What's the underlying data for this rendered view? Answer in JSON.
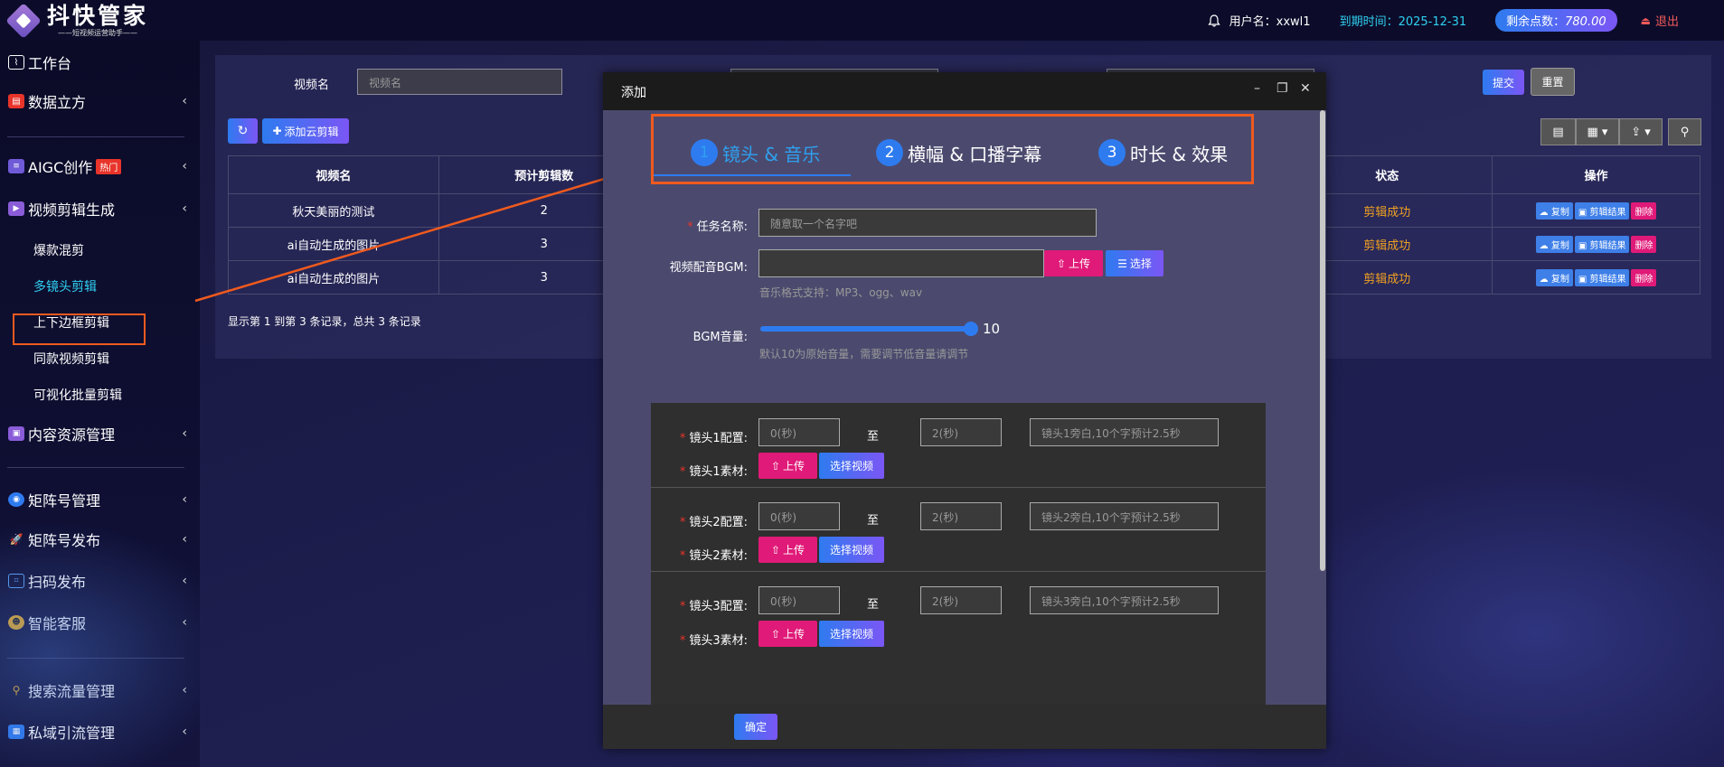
{
  "header": {
    "logo_title": "抖快管家",
    "logo_sub": "——短视频运营助手——",
    "username": "用户名：xxwl1",
    "expire": "到期时间：2025-12-31",
    "points_label": "剩余点数：",
    "points_value": "780.00",
    "logout": "退出"
  },
  "sidebar": {
    "items": [
      {
        "label": "工作台"
      },
      {
        "label": "数据立方"
      },
      {
        "label": "AIGC创作",
        "badge": "热门"
      },
      {
        "label": "视频剪辑生成"
      },
      {
        "label": "内容资源管理"
      },
      {
        "label": "矩阵号管理"
      },
      {
        "label": "矩阵号发布"
      },
      {
        "label": "扫码发布"
      },
      {
        "label": "智能客服"
      },
      {
        "label": "搜索流量管理"
      },
      {
        "label": "私域引流管理"
      }
    ],
    "sub_items": [
      "爆款混剪",
      "多镜头剪辑",
      "上下边框剪辑",
      "同款视频剪辑",
      "可视化批量剪辑"
    ]
  },
  "search": {
    "label": "视频名",
    "placeholder": "视频名",
    "submit": "提交",
    "reset": "重置"
  },
  "toolbar": {
    "add": "添加云剪辑"
  },
  "table": {
    "headers": [
      "视频名",
      "预计剪辑数",
      "状态",
      "操作"
    ],
    "rows": [
      {
        "name": "秋天美丽的测试",
        "count": "2",
        "status": "剪辑成功"
      },
      {
        "name": "ai自动生成的图片",
        "count": "3",
        "status": "剪辑成功"
      },
      {
        "name": "ai自动生成的图片",
        "count": "3",
        "status": "剪辑成功"
      }
    ],
    "ops": {
      "copy": "复制",
      "result": "剪辑结果",
      "del": "删除"
    },
    "pager": "显示第 1 到第 3 条记录，总共 3 条记录"
  },
  "modal": {
    "title": "添加",
    "steps": [
      {
        "num": "1",
        "label": "镜头 & 音乐"
      },
      {
        "num": "2",
        "label": "横幅 & 口播字幕"
      },
      {
        "num": "3",
        "label": "时长 & 效果"
      }
    ],
    "task_label": "任务名称:",
    "task_placeholder": "随意取一个名字吧",
    "bgm_label": "视频配音BGM:",
    "upload": "上传",
    "choose": "选择",
    "bgm_hint": "音乐格式支持：MP3、ogg、wav",
    "volume_label": "BGM音量:",
    "volume_value": "10",
    "volume_hint": "默认10为原始音量，需要调节低音量请调节",
    "to": "至",
    "choose_video": "选择视频",
    "shots": [
      {
        "config_label": "镜头1配置:",
        "material_label": "镜头1素材:",
        "start_ph": "0(秒)",
        "end_ph": "2(秒)",
        "note_ph": "镜头1旁白,10个字预计2.5秒"
      },
      {
        "config_label": "镜头2配置:",
        "material_label": "镜头2素材:",
        "start_ph": "0(秒)",
        "end_ph": "2(秒)",
        "note_ph": "镜头2旁白,10个字预计2.5秒"
      },
      {
        "config_label": "镜头3配置:",
        "material_label": "镜头3素材:",
        "start_ph": "0(秒)",
        "end_ph": "2(秒)",
        "note_ph": "镜头3旁白,10个字预计2.5秒"
      }
    ],
    "ok": "确定"
  }
}
